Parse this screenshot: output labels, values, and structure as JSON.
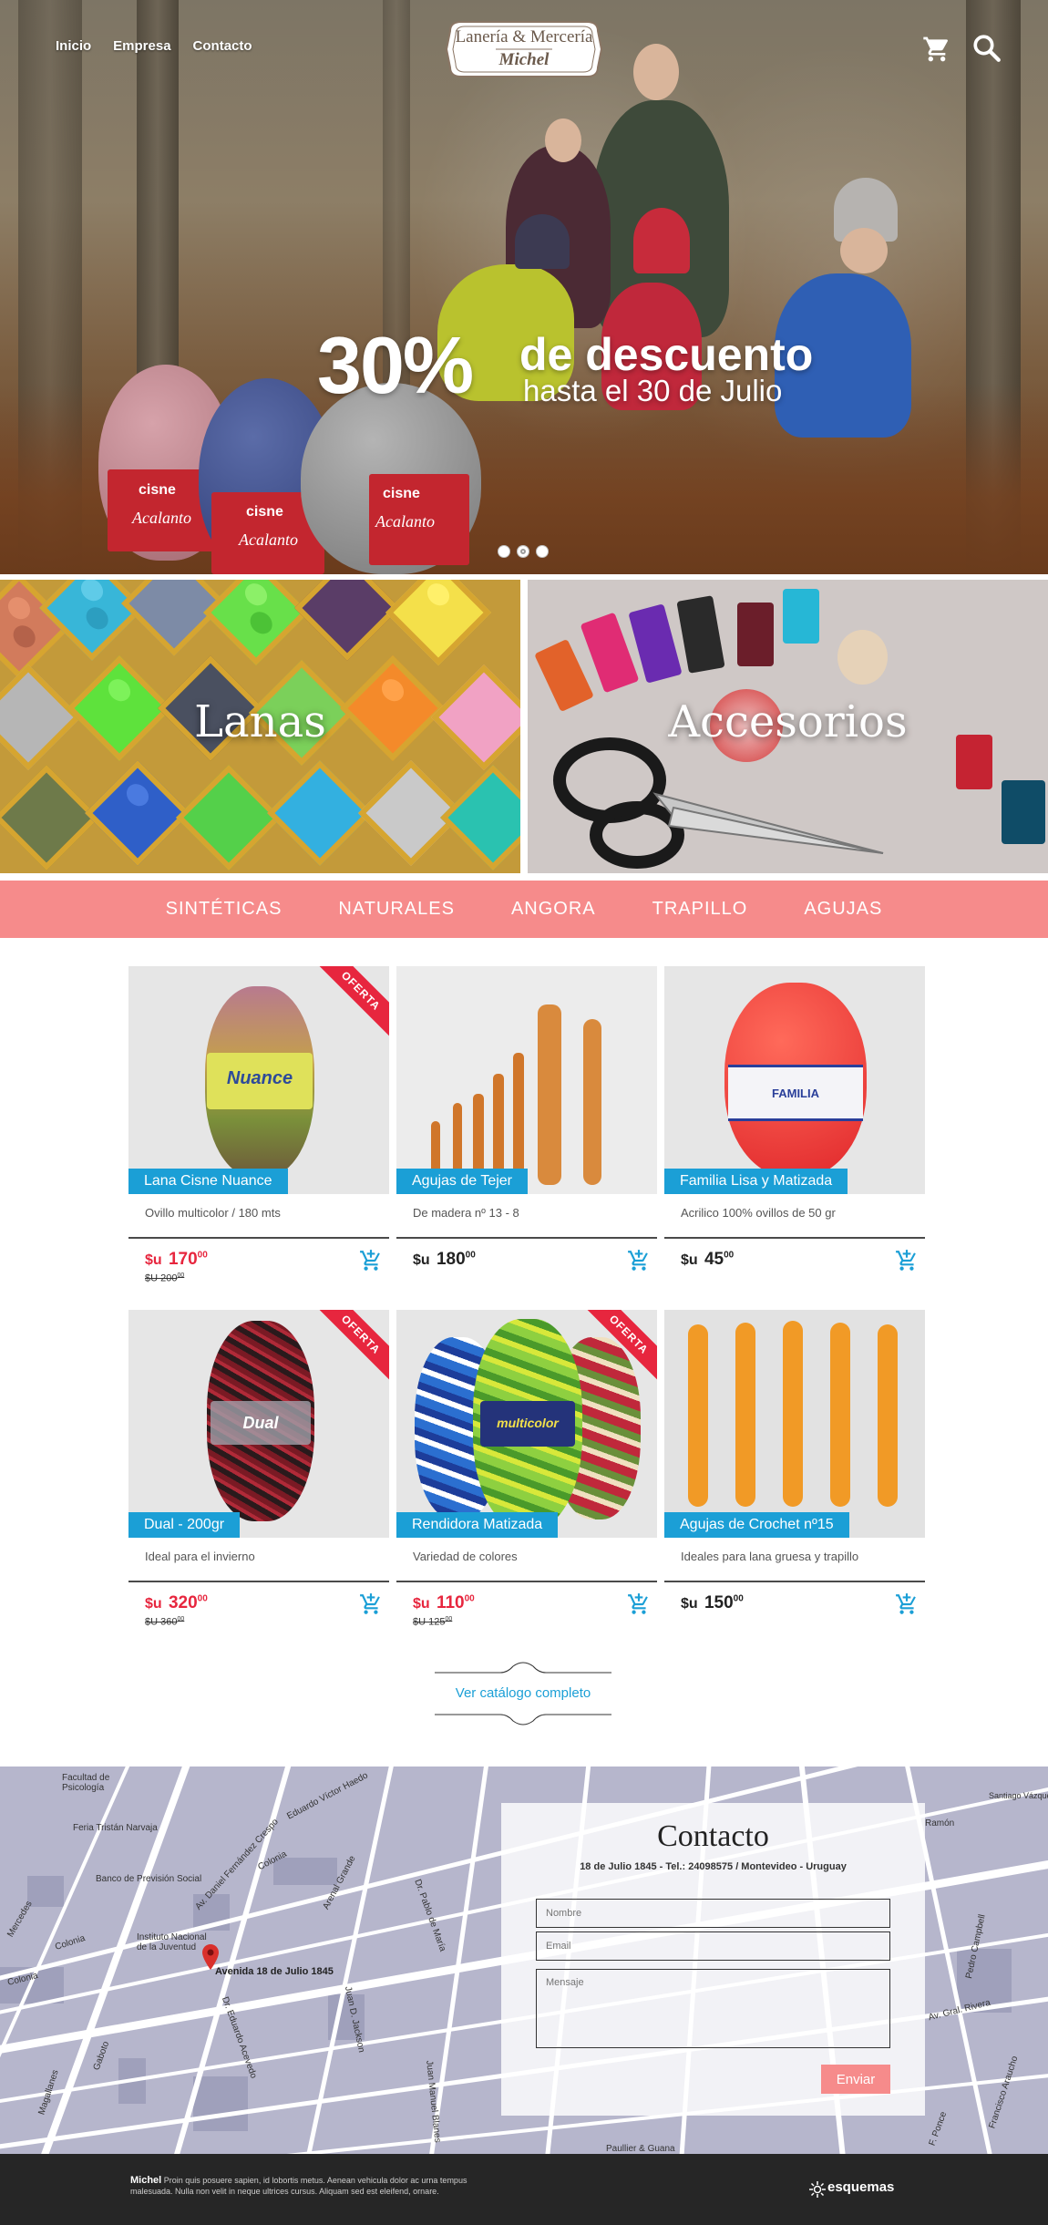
{
  "nav": {
    "items": [
      "Inicio",
      "Empresa",
      "Contacto"
    ]
  },
  "logo": {
    "line1": "Lanería & Mercería",
    "line2": "Michel"
  },
  "promo": {
    "percent": "30%",
    "line1": "de descuento",
    "line2": "hasta el 30 de Julio"
  },
  "slider": {
    "count": 3,
    "active": 1
  },
  "yarn_brand": "cisne",
  "yarn_name": "Acalanto",
  "categories": {
    "lanas": "Lanas",
    "accesorios": "Accesorios"
  },
  "subcategories": [
    "SINTÉTICAS",
    "NATURALES",
    "ANGORA",
    "TRAPILLO",
    "AGUJAS"
  ],
  "currency": "$u",
  "products": [
    {
      "name": "Lana Cisne Nuance",
      "desc": "Ovillo multicolor / 180 mts",
      "price": "170",
      "cents": "00",
      "old_price": "$U 200",
      "old_cents": "00",
      "offer": "OFERTA",
      "img_label": "Nuance"
    },
    {
      "name": "Agujas de Tejer",
      "desc": "De madera nº 13 - 8",
      "price": "180",
      "cents": "00",
      "old_price": "",
      "old_cents": "",
      "offer": "",
      "img_label": ""
    },
    {
      "name": "Familia Lisa y Matizada",
      "desc": "Acrilico 100% ovillos de 50 gr",
      "price": "45",
      "cents": "00",
      "old_price": "",
      "old_cents": "",
      "offer": "",
      "img_label": "FAMILIA"
    },
    {
      "name": "Dual - 200gr",
      "desc": "Ideal para el invierno",
      "price": "320",
      "cents": "00",
      "old_price": "$U 360",
      "old_cents": "00",
      "offer": "OFERTA",
      "img_label": "Dual"
    },
    {
      "name": "Rendidora Matizada",
      "desc": "Variedad de colores",
      "price": "110",
      "cents": "00",
      "old_price": "$U 125",
      "old_cents": "00",
      "offer": "OFERTA",
      "img_label": "multicolor"
    },
    {
      "name": "Agujas de Crochet nº15",
      "desc": "Ideales para lana gruesa y trapillo",
      "price": "150",
      "cents": "00",
      "old_price": "",
      "old_cents": "",
      "offer": "",
      "img_label": ""
    }
  ],
  "catalog_link": "Ver catálogo completo",
  "map_labels": {
    "facultad": "Facultad de Psicología",
    "feria": "Feria Tristán Narvaja",
    "banco": "Banco de Previsión Social",
    "instituto": "Instituto Nacional de la Juventud",
    "colonia1": "Colonia",
    "colonia2": "Colonia",
    "colonia3": "Colonia",
    "mercedes": "Mercedes",
    "avda": "Avenida 18 de Julio 1845",
    "fernandez": "Av. Daniel Fernández Crespo",
    "arenal": "Arenal Grande",
    "eduardo": "Eduardo Víctor Haedo",
    "pablo": "Dr. Pablo de María",
    "jackson": "Juan D. Jackson",
    "acevedo": "Dr. Eduardo Acevedo",
    "gaboto": "Gaboto",
    "magallanes": "Magallanes",
    "ramon": "Ramón",
    "santiago": "Santiago Vázquez",
    "campbell": "Pedro Campbell",
    "rivera": "Av. Gral. Rivera",
    "araucho": "Francisco Araucho",
    "paullier": "Paullier & Guana",
    "ponce": "F. Ponce",
    "manuel": "Juan Manuel Blanes"
  },
  "contact": {
    "title": "Contacto",
    "address": "18 de Julio 1845  -  Tel.: 24098575  /  Montevideo - Uruguay",
    "name_placeholder": "Nombre",
    "email_placeholder": "Email",
    "message_placeholder": "Mensaje",
    "send": "Enviar"
  },
  "footer": {
    "brand_name": "Michel",
    "text": "Proin quis posuere sapien, id lobortis metus. Aenean vehicula dolor ac urna tempus malesuada. Nulla non velit in neque ultrices cursus. Aliquam sed est eleifend, ornare.",
    "agency": "esquemas"
  }
}
